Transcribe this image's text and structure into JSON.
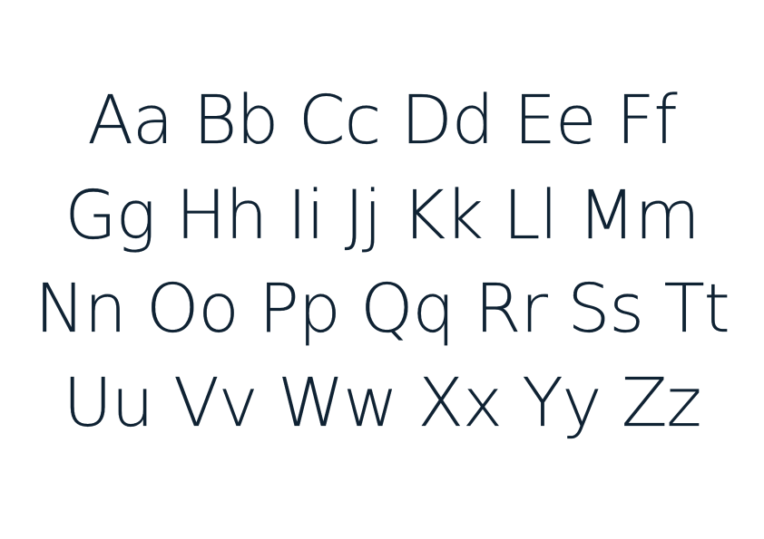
{
  "specimen": {
    "lines": [
      "Aa Bb Cc Dd Ee Ff",
      "Gg Hh Ii Jj Kk Ll Mm",
      "Nn Oo Pp Qq Rr Ss Tt",
      "Uu Vv Ww Xx Yy Zz"
    ],
    "text_color": "#0f2233",
    "background_color": "#ffffff"
  }
}
